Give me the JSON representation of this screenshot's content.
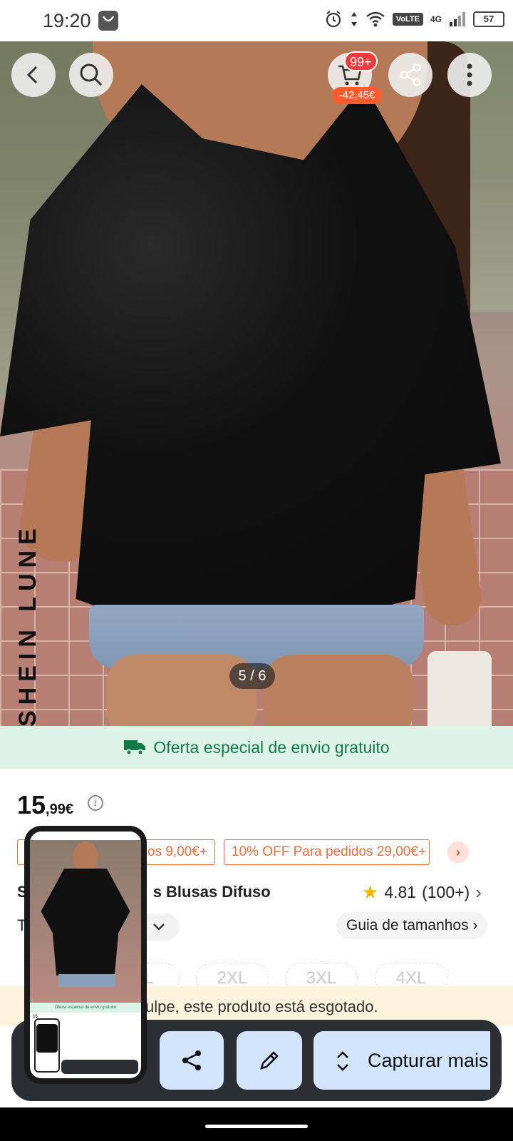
{
  "status_bar": {
    "time": "19:20",
    "network": "4G",
    "volte": "VoLTE",
    "battery": "57"
  },
  "product_image": {
    "brand_watermark": "SHEIN LUNE",
    "counter": "5 / 6"
  },
  "top_actions": {
    "cart_badge": "99+",
    "cart_discount": "-42,45€"
  },
  "shipping_banner": {
    "text": "Oferta especial de envio gratuito",
    "color": "#137a4a"
  },
  "price": {
    "main": "15",
    "cents": ",99€"
  },
  "coupons": [
    "dos 9,00€+",
    "10% OFF Para pedidos 29,00€+"
  ],
  "product": {
    "title_visible_start": "S",
    "title_visible_end": "s Blusas Difuso",
    "rating": "4.81",
    "rating_count": "(100+)",
    "row_label": "T",
    "size_guide": "Guia de tamanhos"
  },
  "sizes": [
    "XL",
    "2XL",
    "3XL",
    "4XL"
  ],
  "sold_out_notice": "ulpe, este produto está esgotado.",
  "capture_toolbar": {
    "more_label": "Capturar mais",
    "accent": "#d3e4fd"
  },
  "thumbnail": {
    "ship_text": "Oferta especial de envio gratuito",
    "price": "15"
  }
}
